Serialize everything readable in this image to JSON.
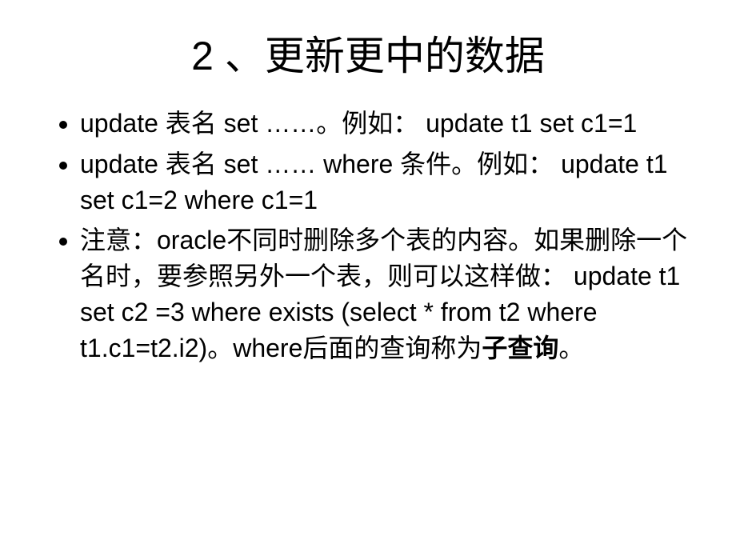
{
  "slide": {
    "title": "2 、更新更中的数据",
    "bullets": [
      "update 表名 set ……。例如： update t1 set c1=1",
      "update 表名 set ……  where 条件。例如： update t1 set c1=2  where c1=1",
      {
        "pre": "注意：oracle不同时删除多个表的内容。如果删除一个名时，要参照另外一个表，则可以这样做： update t1 set c2 =3 where exists (select * from t2 where t1.c1=t2.i2)。where后面的查询称为",
        "bold": "子查询",
        "post": "。"
      }
    ]
  }
}
